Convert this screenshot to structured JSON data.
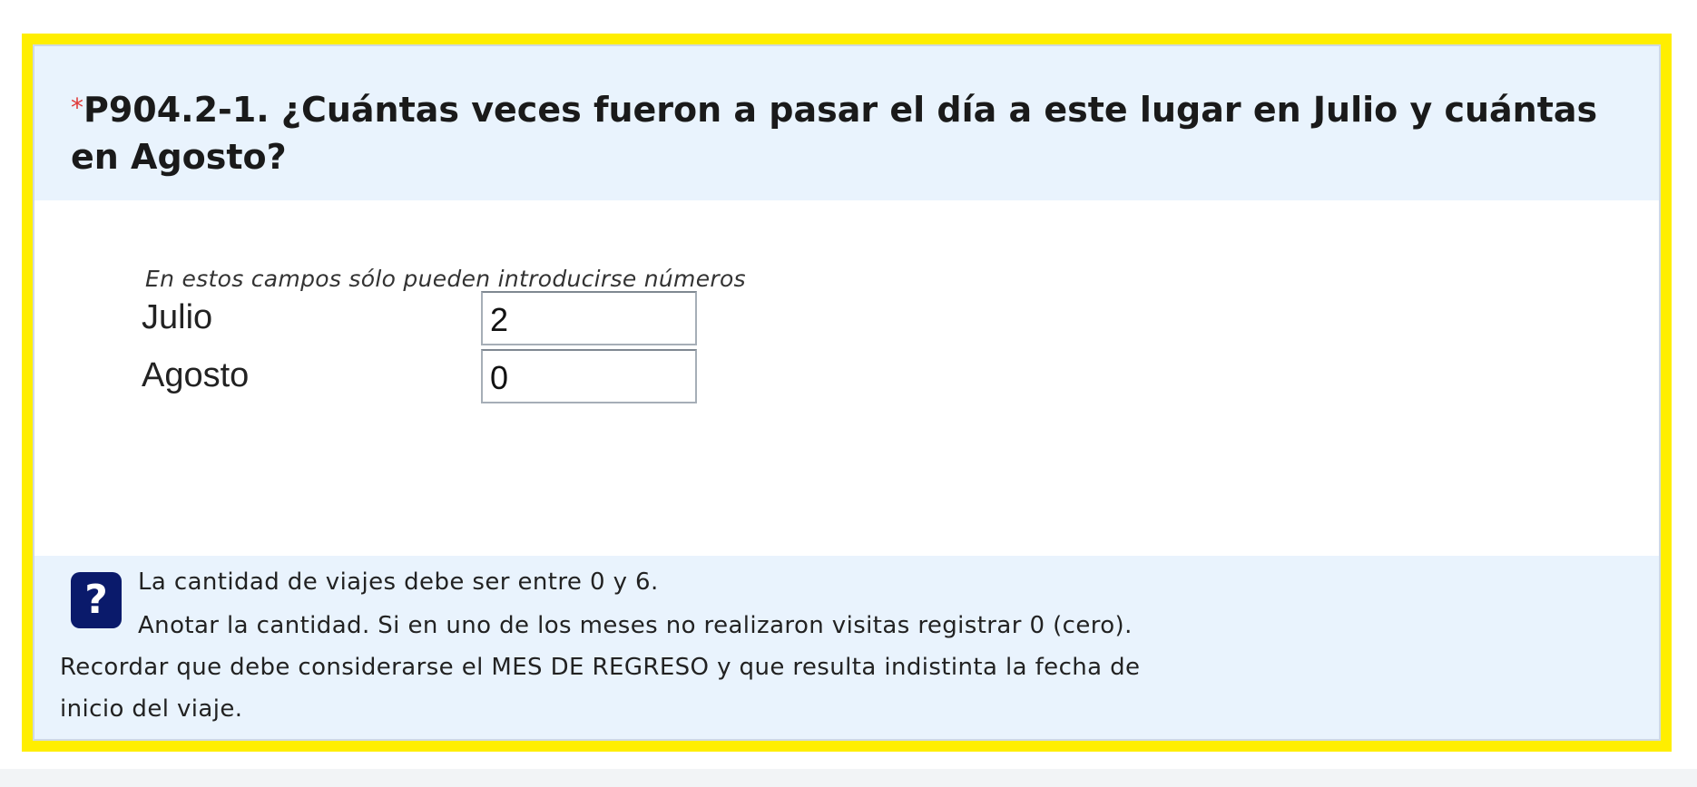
{
  "question": {
    "required_marker": "*",
    "title": "P904.2-1. ¿Cuántas veces fueron a pasar el día a este lugar en Julio y cuántas en Agosto?"
  },
  "hint": "En estos campos sólo pueden introducirse números",
  "fields": [
    {
      "label": "Julio",
      "value": "2"
    },
    {
      "label": "Agosto",
      "value": "0"
    }
  ],
  "help": {
    "icon": "question-mark-icon",
    "icon_glyph": "?",
    "lines": [
      "La cantidad de viajes debe ser entre 0 y 6.",
      "Anotar la cantidad. Si en uno de los meses no realizaron visitas registrar 0 (cero).",
      "Recordar que debe considerarse el MES DE REGRESO y que resulta indistinta la fecha de",
      "inicio del viaje."
    ]
  },
  "colors": {
    "frame_highlight": "#ffee00",
    "header_background": "#e9f3fd",
    "required_marker": "#e03b3b",
    "help_icon_background": "#0a1a6b"
  }
}
